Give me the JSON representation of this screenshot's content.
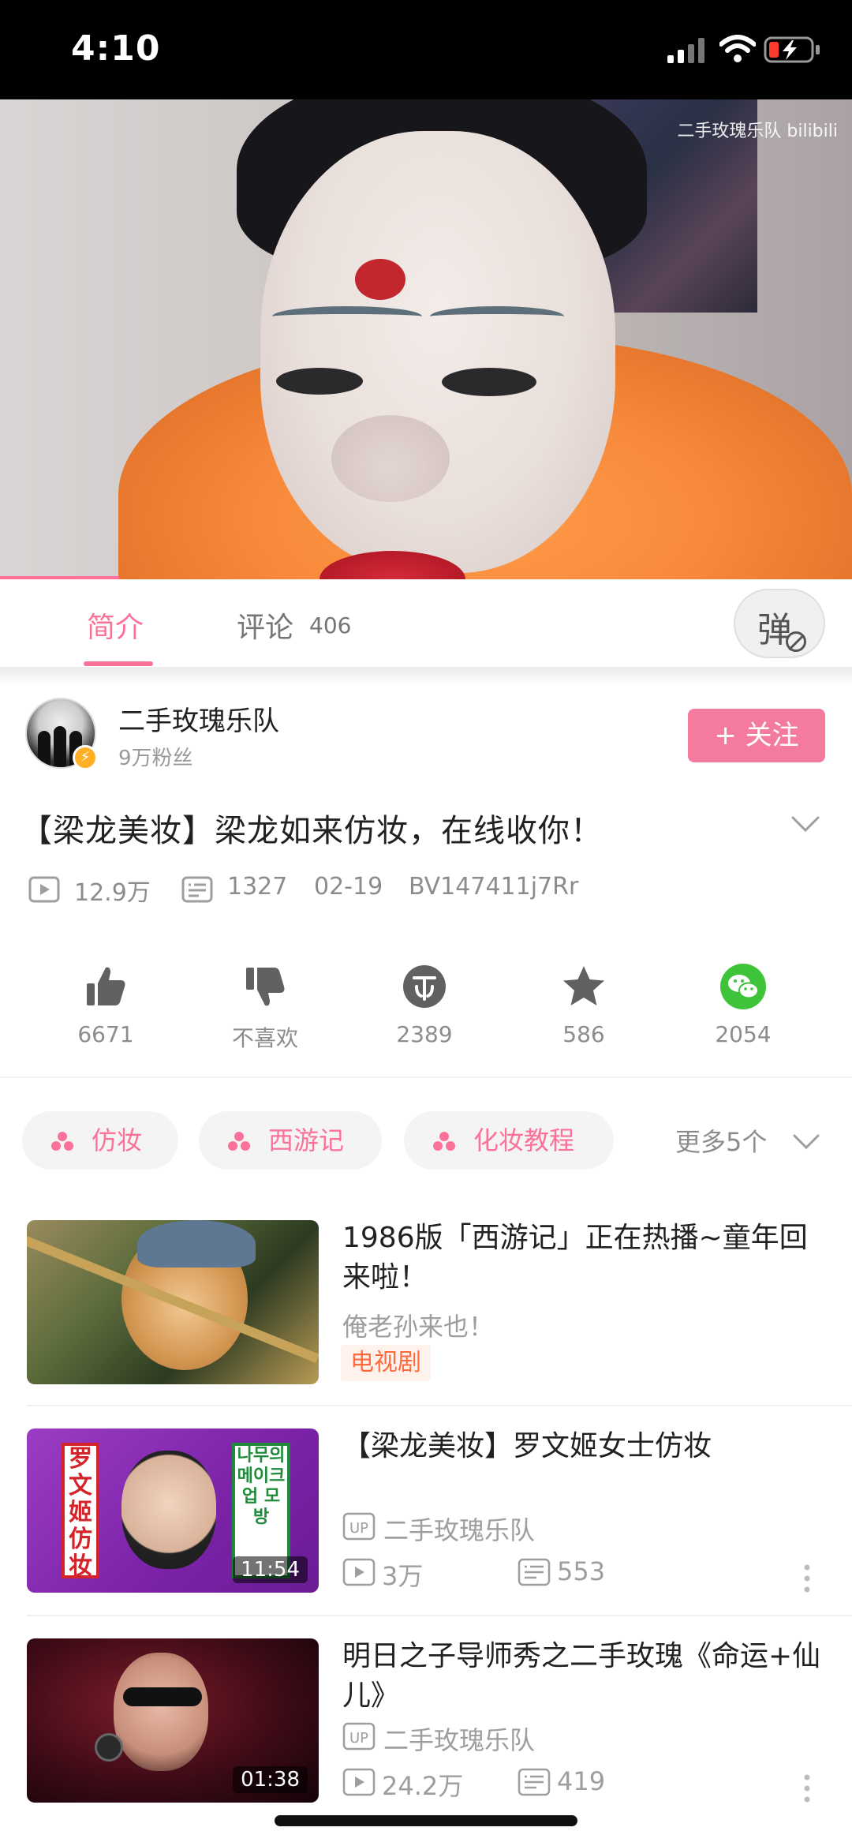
{
  "status_bar": {
    "time": "4:10"
  },
  "video": {
    "watermark": "二手玫瑰乐队 bilibili",
    "progress_fraction": 0.14
  },
  "tabs": {
    "intro": "简介",
    "comments": "评论",
    "comments_count": "406",
    "danmaku_glyph": "弹"
  },
  "uploader": {
    "name": "二手玫瑰乐队",
    "fans": "9万粉丝",
    "follow_label": "+ 关注"
  },
  "video_info": {
    "title": "【梁龙美妆】梁龙如来仿妆，在线收你！",
    "views": "12.9万",
    "danmaku": "1327",
    "date": "02-19",
    "bvid": "BV147411j7Rr"
  },
  "actions": {
    "like": "6671",
    "dislike": "不喜欢",
    "coin": "2389",
    "favorite": "586",
    "share": "2054"
  },
  "tags": {
    "items": [
      "仿妆",
      "西游记",
      "化妆教程"
    ],
    "more": "更多5个"
  },
  "recommendations": [
    {
      "title": "1986版「西游记」正在热播~童年回来啦！",
      "subtitle": "俺老孙来也！",
      "badge": "电视剧"
    },
    {
      "title": "【梁龙美妆】罗文姬女士仿妆",
      "up_badge": "UP",
      "author": "二手玫瑰乐队",
      "views": "3万",
      "danmaku": "553",
      "duration": "11:54",
      "thumb_text_left": "罗文姬仿妆",
      "thumb_text_right": "나무의 메이크업 모방"
    },
    {
      "title": "明日之子导师秀之二手玫瑰《命运+仙儿》",
      "up_badge": "UP",
      "author": "二手玫瑰乐队",
      "views": "24.2万",
      "danmaku": "419",
      "duration": "01:38"
    }
  ],
  "colors": {
    "accent": "#fb7299",
    "follow": "#f47b9e",
    "share_green": "#3fc33b",
    "badge_orange": "#ff6a3d"
  }
}
